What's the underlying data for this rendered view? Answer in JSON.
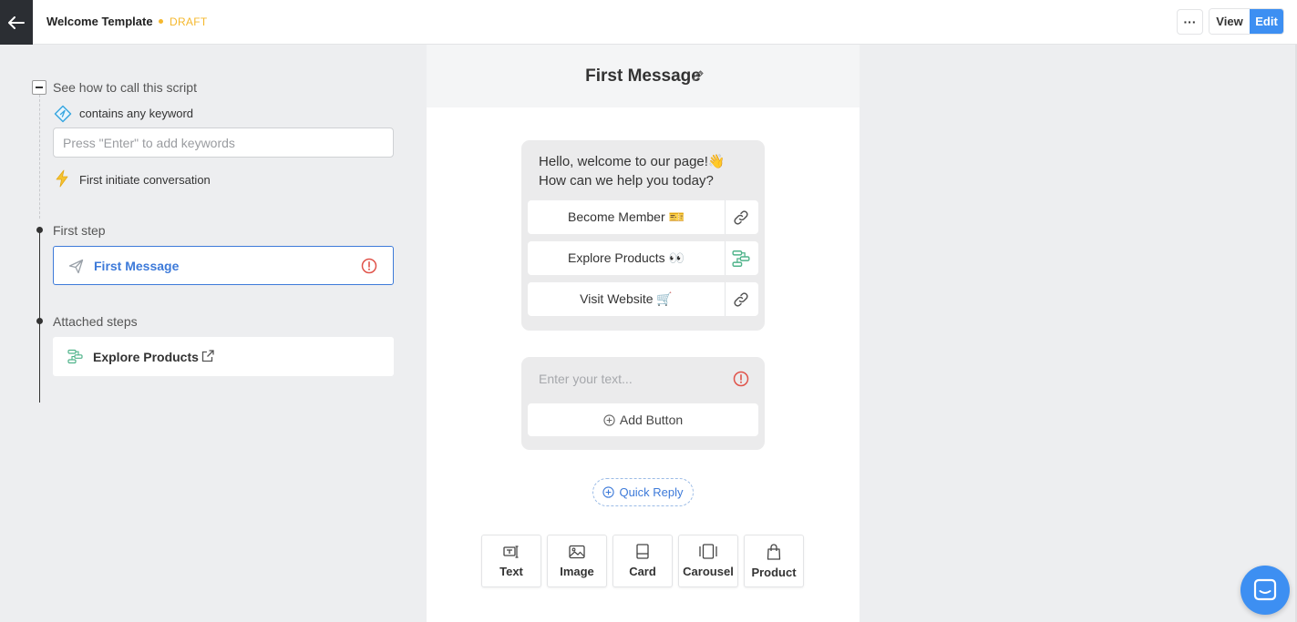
{
  "header": {
    "title": "Welcome Template",
    "status": "DRAFT",
    "more_label": "···",
    "view_label": "View",
    "edit_label": "Edit"
  },
  "sidebar": {
    "collapse_label": "See how to call this script",
    "keyword_rule": "contains any keyword",
    "keyword_placeholder": "Press \"Enter\" to add keywords",
    "initiate_label": "First initiate conversation",
    "first_step_heading": "First step",
    "first_step_item": "First Message",
    "attached_heading": "Attached steps",
    "attached_item": "Explore Products"
  },
  "editor": {
    "title": "First Message",
    "message_text": "Hello, welcome to our page!👋\nHow can we help you today?",
    "buttons": [
      {
        "label": "Become Member 🎫",
        "icon": "link-icon"
      },
      {
        "label": "Explore Products 👀",
        "icon": "flow-icon"
      },
      {
        "label": "Visit Website 🛒",
        "icon": "link-icon"
      }
    ],
    "text_placeholder": "Enter your text...",
    "add_button_label": "Add Button",
    "quick_reply_label": "Quick Reply",
    "tools": [
      {
        "label": "Text",
        "icon": "text-icon"
      },
      {
        "label": "Image",
        "icon": "image-icon"
      },
      {
        "label": "Card",
        "icon": "card-icon"
      },
      {
        "label": "Carousel",
        "icon": "carousel-icon"
      },
      {
        "label": "Product",
        "icon": "bag-icon"
      }
    ]
  },
  "colors": {
    "accent": "#3d8ff2",
    "link_blue": "#3d7ad9",
    "draft": "#f5b82e",
    "warning": "#e0534a",
    "flow_green": "#4fb38a"
  }
}
